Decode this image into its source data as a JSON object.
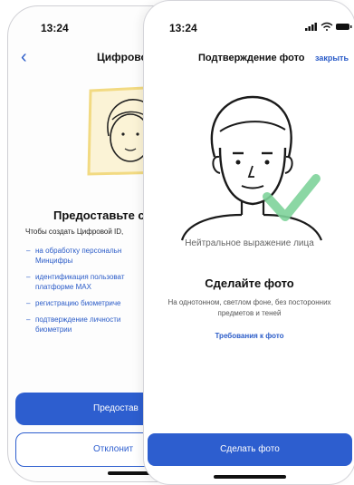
{
  "back_screen": {
    "time": "13:24",
    "title": "Цифровой",
    "heading": "Предоставьте с",
    "intro": "Чтобы создать Цифровой ID,",
    "list": [
      {
        "text": "на обработку персональн Минцифры"
      },
      {
        "text": "идентификация пользоват платформе MAX"
      },
      {
        "text": "регистрацию биометриче"
      },
      {
        "text": "подтверждение личности биометрии"
      }
    ],
    "primary_button": "Предостав",
    "secondary_button": "Отклонит"
  },
  "front_screen": {
    "time": "13:24",
    "title": "Подтверждение фото",
    "close": "закрыть",
    "hint": "Нейтральное выражение лица",
    "heading": "Сделайте фото",
    "description": "На однотонном, светлом фоне, без посторонних предметов и теней",
    "requirements_link": "Требования к фото",
    "action_button": "Сделать фото"
  },
  "colors": {
    "accent": "#2D5ECF",
    "link": "#2B5CC8",
    "check": "#7ED39A",
    "illustration_frame": "#F2DA82"
  },
  "icons": [
    "back-chevron-icon",
    "signal-icon",
    "wifi-icon",
    "battery-icon",
    "face-illustration",
    "checkmark-icon"
  ]
}
